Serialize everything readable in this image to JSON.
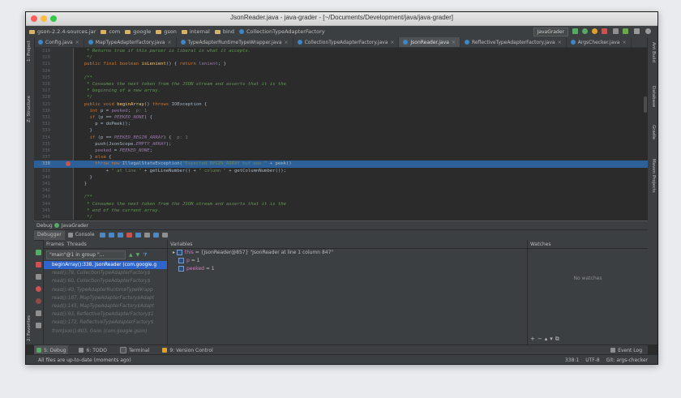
{
  "window": {
    "title": "JsonReader.java - java-grader - [~/Documents/Development/java/java-grader]"
  },
  "breadcrumbs": [
    "gson-2.2.4-sources.jar",
    "com",
    "google",
    "gson",
    "internal",
    "bind",
    "CollectionTypeAdapterFactory"
  ],
  "run_config": "JavaGrader",
  "tabs": [
    {
      "label": "Config.java",
      "active": false
    },
    {
      "label": "MapTypeAdapterFactory.java",
      "active": false
    },
    {
      "label": "TypeAdapterRuntimeTypeWrapper.java",
      "active": false
    },
    {
      "label": "CollectionTypeAdapterFactory.java",
      "active": false
    },
    {
      "label": "JsonReader.java",
      "active": true
    },
    {
      "label": "ReflectiveTypeAdapterFactory.java",
      "active": false
    },
    {
      "label": "ArgsChecker.java",
      "active": false
    }
  ],
  "left_tool_tabs": [
    "1: Project",
    "Z: Structure",
    "2: Favorites"
  ],
  "right_tool_tabs": [
    "Ant Build",
    "Database",
    "Gradle",
    "Maven Projects"
  ],
  "code": {
    "lines": [
      {
        "n": "319",
        "text": "   * Returns true if this parser is liberal in what it accepts."
      },
      {
        "n": "320",
        "text": "   */"
      },
      {
        "n": "321",
        "text": "  public final boolean isLenient() { return lenient; }"
      },
      {
        "n": "324",
        "text": ""
      },
      {
        "n": "325",
        "text": "  /**"
      },
      {
        "n": "326",
        "text": "   * Consumes the next token from the JSON stream and asserts that it is the"
      },
      {
        "n": "327",
        "text": "   * beginning of a new array."
      },
      {
        "n": "328",
        "text": "   */"
      },
      {
        "n": "329",
        "text": "  public void beginArray() throws IOException {"
      },
      {
        "n": "330",
        "text": "    int p = peeked;  p: 1"
      },
      {
        "n": "331",
        "text": "    if (p == PEEKED_NONE) {"
      },
      {
        "n": "332",
        "text": "      p = doPeek();"
      },
      {
        "n": "333",
        "text": "    }"
      },
      {
        "n": "334",
        "text": "    if (p == PEEKED_BEGIN_ARRAY) {  p: 1"
      },
      {
        "n": "335",
        "text": "      push(JsonScope.EMPTY_ARRAY);"
      },
      {
        "n": "336",
        "text": "      peeked = PEEKED_NONE;"
      },
      {
        "n": "337",
        "text": "    } else {"
      },
      {
        "n": "338",
        "text": "      throw new IllegalStateException(\"Expected BEGIN_ARRAY but was \" + peek()"
      },
      {
        "n": "339",
        "text": "          + \" at line \" + getLineNumber() + \" column \" + getColumnNumber());"
      },
      {
        "n": "340",
        "text": "    }"
      },
      {
        "n": "341",
        "text": "  }"
      },
      {
        "n": "342",
        "text": ""
      },
      {
        "n": "343",
        "text": "  /**"
      },
      {
        "n": "344",
        "text": "   * Consumes the next token from the JSON stream and asserts that it is the"
      },
      {
        "n": "345",
        "text": "   * end of the current array."
      },
      {
        "n": "346",
        "text": "   */"
      },
      {
        "n": "347",
        "text": "  public void endArray() throws IOException {"
      }
    ],
    "highlighted_line": "338"
  },
  "debug": {
    "header": "Debug",
    "config": "JavaGrader",
    "tab_debugger": "Debugger",
    "tab_console": "Console",
    "frames_label": "Frames",
    "threads_label": "Threads",
    "variables_label": "Variables",
    "watches_label": "Watches",
    "thread_selector": "\"main\"@1 in group \"...",
    "frames": [
      "beginArray():338, JsonReader (com.google.g",
      "read():79, CollectionTypeAdapterFactory$",
      "read():60, CollectionTypeAdapterFactory$",
      "read():40, TypeAdapterRuntimeTypeWrapp",
      "read():187, MapTypeAdapterFactory$Adapt",
      "read():145, MapTypeAdapterFactory$Adapt",
      "read():93, ReflectiveTypeAdapterFactory$1",
      "read():172, ReflectiveTypeAdapterFactory$",
      "fromJson():803, Gson (com.google.gson)"
    ],
    "variables": [
      {
        "name": "this",
        "value": "= {JsonReader@857} \"JsonReader at line 1 column 847\""
      },
      {
        "name": "p",
        "value": "= 1"
      },
      {
        "name": "peeked",
        "value": "= 1"
      }
    ],
    "no_watches": "No watches"
  },
  "tool_windows": [
    {
      "label": "5: Debug",
      "active": true
    },
    {
      "label": "6: TODO",
      "active": false
    },
    {
      "label": "Terminal",
      "active": false
    },
    {
      "label": "9: Version Control",
      "active": false
    },
    {
      "label": "Event Log",
      "active": false
    }
  ],
  "status": {
    "message": "All files are up-to-date (moments ago)",
    "position": "338:1",
    "encoding": "UTF-8",
    "vcs": "Git: args-checker"
  },
  "colors": {
    "editor_bg": "#2b2b2b",
    "panel_bg": "#3c3f41",
    "selection": "#2d6099",
    "keyword": "#cc7832",
    "comment": "#629755"
  }
}
